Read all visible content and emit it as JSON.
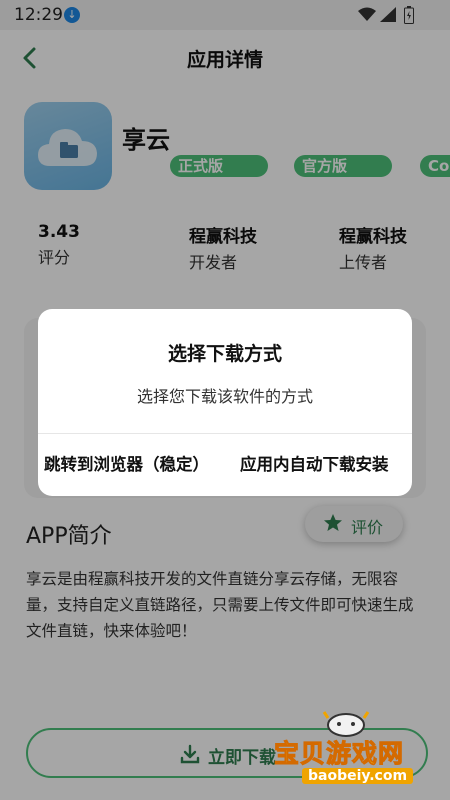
{
  "status_bar": {
    "time": "12:29"
  },
  "header": {
    "title": "应用详情"
  },
  "app": {
    "name": "享云",
    "tags": [
      "正式版",
      "官方版",
      "Co"
    ],
    "stats": [
      {
        "value": "3.43",
        "label": "评分"
      },
      {
        "value": "程赢科技",
        "label": "开发者"
      },
      {
        "value": "程赢科技",
        "label": "上传者"
      }
    ]
  },
  "section": {
    "title": "APP简介",
    "rate_label": "评价",
    "description": "享云是由程赢科技开发的文件直链分享云存储，无限容量，支持自定义直链路径，只需要上传文件即可快速生成文件直链，快来体验吧！"
  },
  "download": {
    "label": "立即下载"
  },
  "watermark": {
    "text": "宝贝游戏网",
    "url": "baobeiy.com"
  },
  "dialog": {
    "title": "选择下载方式",
    "message": "选择您下载该软件的方式",
    "btn_browser": "跳转到浏览器（稳定）",
    "btn_inapp": "应用内自动下载安装"
  },
  "colors": {
    "accent": "#4ec07a",
    "accent_text": "#2e7d4f",
    "icon_bg": "#8cc8ec"
  }
}
